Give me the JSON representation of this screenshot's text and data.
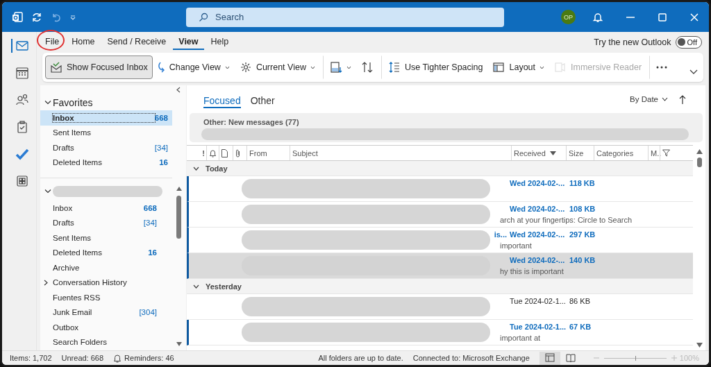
{
  "title_bar": {
    "search_placeholder": "Search",
    "avatar_initials": "OP"
  },
  "rail": [
    {
      "selected": true
    },
    {
      "selected": false
    },
    {
      "selected": false
    },
    {
      "selected": false
    },
    {
      "selected": false
    },
    {
      "selected": false
    }
  ],
  "menu_tabs": [
    {
      "label": "File",
      "selected": false,
      "circled": true
    },
    {
      "label": "Home",
      "selected": false,
      "circled": false
    },
    {
      "label": "Send / Receive",
      "selected": false,
      "circled": false
    },
    {
      "label": "View",
      "selected": true,
      "circled": false
    },
    {
      "label": "Help",
      "selected": false,
      "circled": false
    }
  ],
  "new_outlook": {
    "label": "Try the new Outlook",
    "toggle_text": "Off",
    "on": false
  },
  "ribbon": [
    {
      "kind": "toggle",
      "label": "Show Focused Inbox",
      "pressed": true,
      "disabled": false,
      "separator_before": false
    },
    {
      "kind": "dropdown",
      "label": "Change View",
      "pressed": false,
      "disabled": false,
      "separator_before": false
    },
    {
      "kind": "dropdown",
      "label": "Current View",
      "pressed": false,
      "disabled": false,
      "separator_before": false
    },
    {
      "kind": "icon-dropdown",
      "pressed": false,
      "disabled": false,
      "separator_before": true
    },
    {
      "kind": "icon",
      "pressed": false,
      "disabled": false,
      "separator_before": false
    },
    {
      "kind": "button",
      "label": "Use Tighter Spacing",
      "pressed": false,
      "disabled": false,
      "separator_before": true
    },
    {
      "kind": "dropdown",
      "label": "Layout",
      "pressed": false,
      "disabled": false,
      "separator_before": false
    },
    {
      "kind": "button",
      "label": "Immersive Reader",
      "pressed": false,
      "disabled": true,
      "separator_before": false
    },
    {
      "kind": "more",
      "pressed": false,
      "disabled": false,
      "separator_before": true
    }
  ],
  "folder_pane": {
    "favorites": {
      "title": "Favorites",
      "expanded": true,
      "items": [
        {
          "name": "Inbox",
          "count": "668",
          "count_bold": true,
          "selected": true
        },
        {
          "name": "Sent Items",
          "selected": false
        },
        {
          "name": "Drafts",
          "count": "[34]",
          "count_bold": false,
          "selected": false
        },
        {
          "name": "Deleted Items",
          "count": "16",
          "count_bold": true,
          "selected": false
        }
      ]
    },
    "account": {
      "expanded": true,
      "items": [
        {
          "name": "Inbox",
          "count": "668",
          "count_bold": true,
          "selected": false
        },
        {
          "name": "Drafts",
          "count": "[34]",
          "count_bold": false,
          "selected": false
        },
        {
          "name": "Sent Items",
          "selected": false
        },
        {
          "name": "Deleted Items",
          "count": "16",
          "count_bold": true,
          "selected": false
        },
        {
          "name": "Archive",
          "selected": false
        },
        {
          "name": "Conversation History",
          "selected": false,
          "expanded": false
        },
        {
          "name": "Fuentes RSS",
          "selected": false
        },
        {
          "name": "Junk Email",
          "count": "[304]",
          "count_bold": false,
          "selected": false
        },
        {
          "name": "Outbox",
          "selected": false
        },
        {
          "name": "Search Folders",
          "selected": false
        }
      ]
    }
  },
  "message_list": {
    "tabs": [
      {
        "label": "Focused",
        "selected": true
      },
      {
        "label": "Other",
        "selected": false
      }
    ],
    "sort": "By Date",
    "other_banner": "Other: New messages (77)",
    "columns": [
      {
        "kind": "importance",
        "label": "!"
      },
      {
        "kind": "reminder"
      },
      {
        "kind": "type"
      },
      {
        "kind": "attachment"
      },
      {
        "kind": "text",
        "label": "From"
      },
      {
        "kind": "text",
        "label": "Subject"
      },
      {
        "kind": "sorted",
        "label": "Received"
      },
      {
        "kind": "text",
        "label": "Size"
      },
      {
        "kind": "text",
        "label": "Categories"
      },
      {
        "kind": "text",
        "label": "M.."
      },
      {
        "kind": "flag"
      }
    ],
    "groups": [
      {
        "label": "Today",
        "expanded": true,
        "messages": [
          {
            "unread": true,
            "selected": false,
            "received": "Wed 2024-02-...",
            "size": "118 KB"
          },
          {
            "unread": true,
            "selected": false,
            "received": "Wed 2024-02-...",
            "size": "108 KB",
            "preview": "arch at your fingertips: Circle to Search"
          },
          {
            "unread": true,
            "selected": false,
            "subject": "is...",
            "received": "Wed 2024-02-...",
            "size": "297 KB",
            "preview": "important"
          },
          {
            "unread": true,
            "selected": true,
            "received": "Wed 2024-02-...",
            "size": "140 KB",
            "preview": "hy this is important"
          }
        ]
      },
      {
        "label": "Yesterday",
        "expanded": true,
        "messages": [
          {
            "unread": false,
            "selected": false,
            "received": "Tue 2024-02-1...",
            "size": "86 KB"
          },
          {
            "unread": true,
            "selected": false,
            "received": "Tue 2024-02-1...",
            "size": "67 KB",
            "preview": "important at"
          }
        ]
      }
    ]
  },
  "status_bar": {
    "items": "Items: 1,702",
    "unread": "Unread: 668",
    "reminders": "Reminders: 46",
    "sync": "All folders are up to date.",
    "connection": "Connected to: Microsoft Exchange",
    "views": [
      {
        "selected": true
      },
      {
        "selected": false
      }
    ],
    "zoom": {
      "level": 0.5,
      "reading": "100%"
    }
  }
}
